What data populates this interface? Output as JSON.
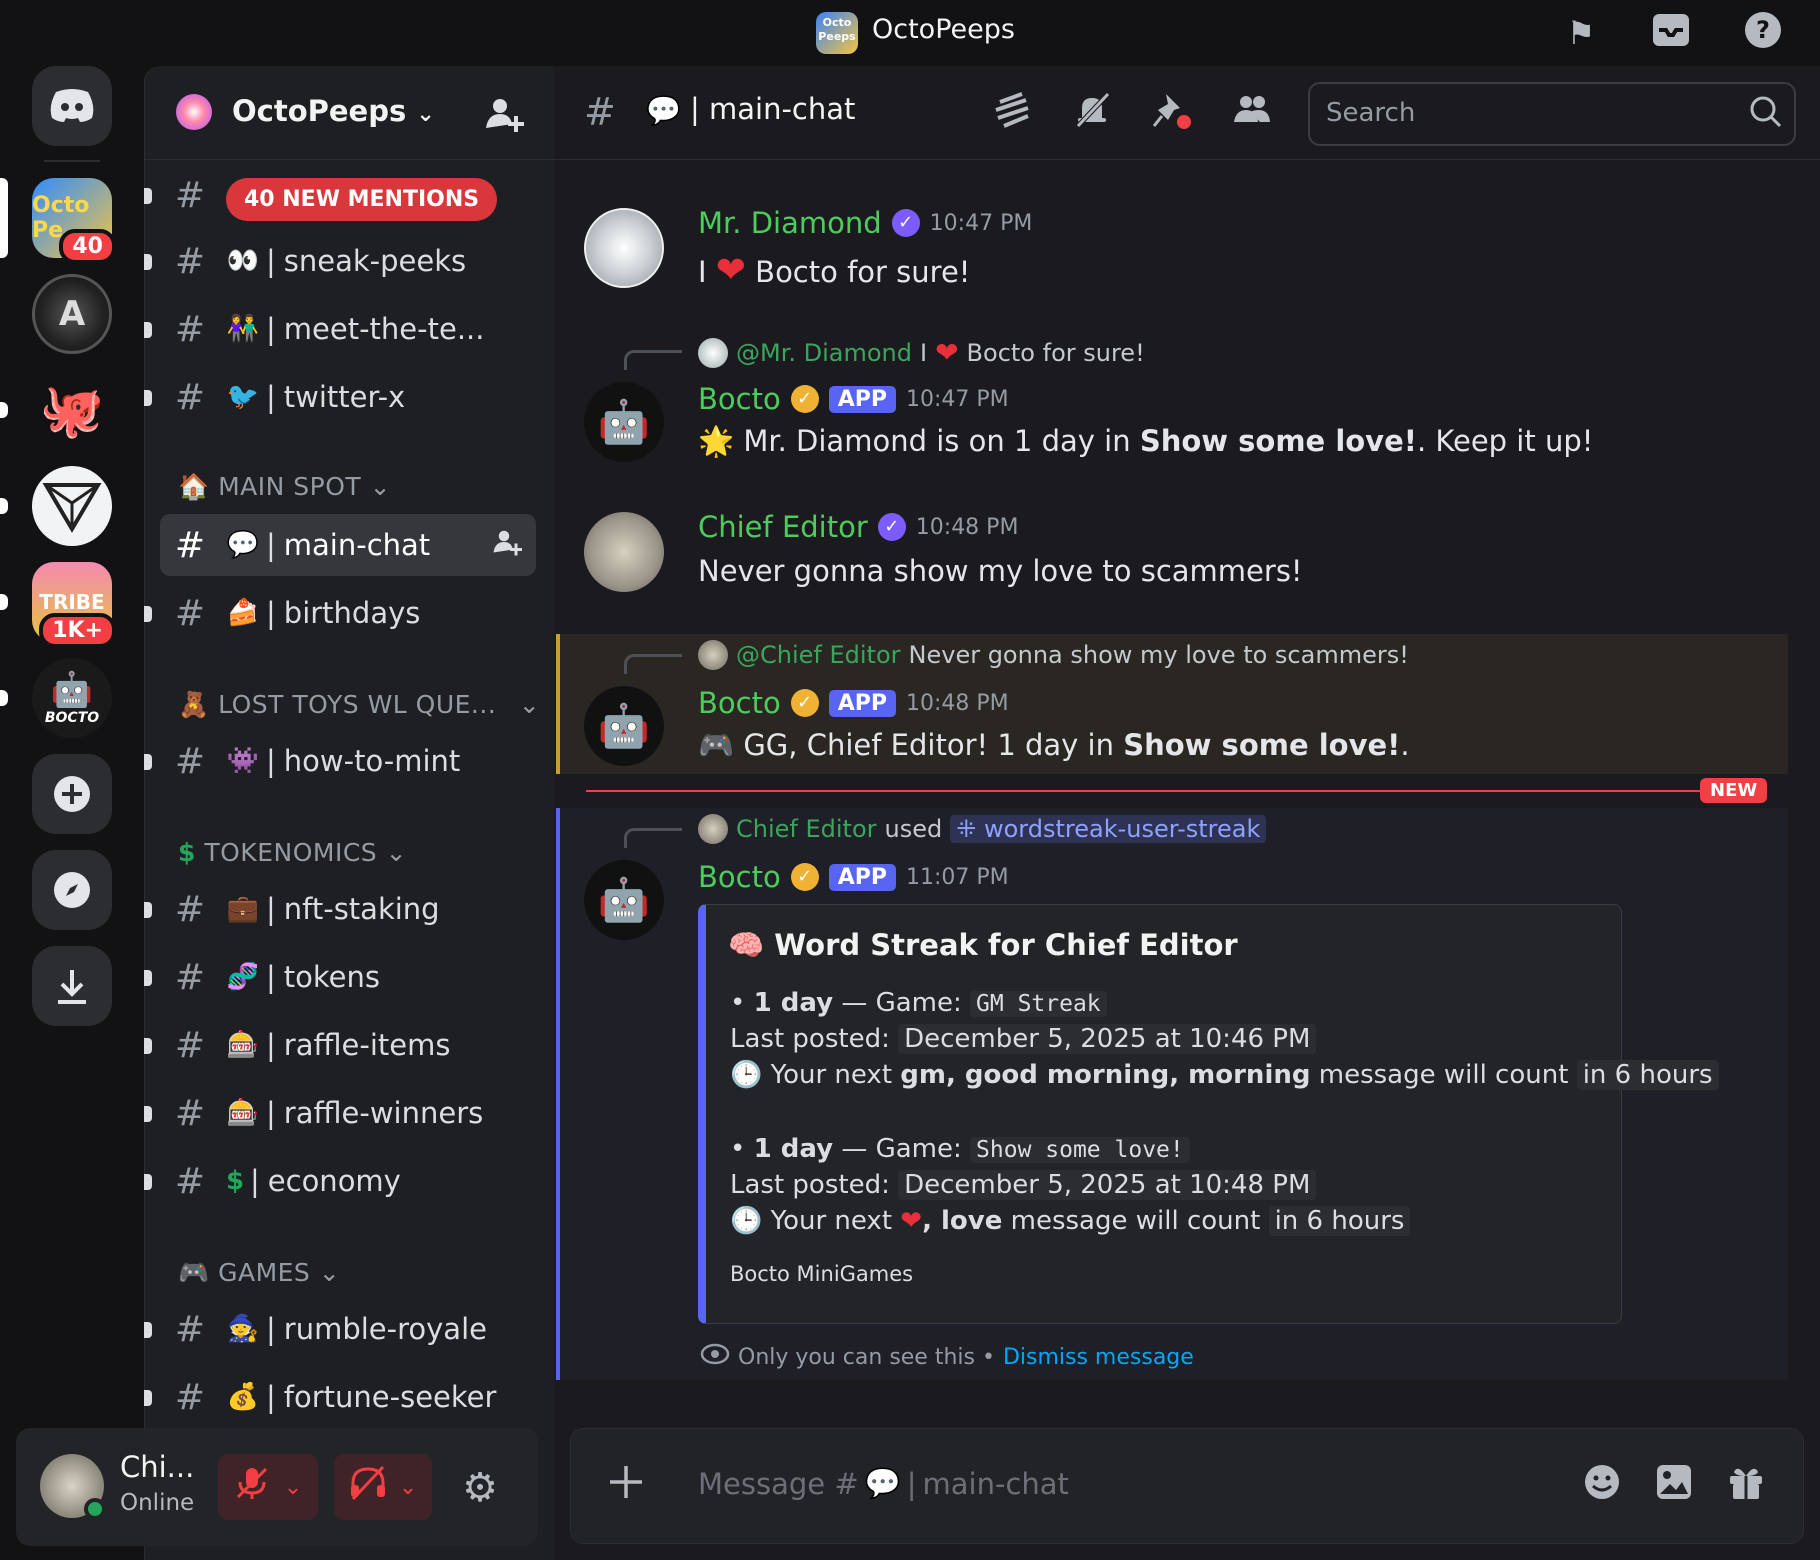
{
  "titlebar": {
    "logo_text": "Octo Peeps",
    "title": "OctoPeeps"
  },
  "rail": {
    "servers": [
      {
        "name": "discord-home",
        "label": "",
        "badge": ""
      },
      {
        "name": "octopeeps",
        "label": "Octo Pe",
        "badge": "40"
      },
      {
        "name": "server-a",
        "label": "A",
        "badge": ""
      },
      {
        "name": "server-octo-miner",
        "label": "",
        "badge": ""
      },
      {
        "name": "server-triangle",
        "label": "",
        "badge": ""
      },
      {
        "name": "server-tribe",
        "label": "TRIBE",
        "badge": "1K+"
      },
      {
        "name": "server-bocto",
        "label": "BOCTO",
        "badge": ""
      }
    ]
  },
  "sidebar": {
    "server_name": "OctoPeeps",
    "mentions_pill": "40 NEW MENTIONS",
    "channels_top": [
      {
        "emoji": "👀",
        "name": "sneak-peeks",
        "locked": true
      },
      {
        "emoji": "👫",
        "name": "meet-the-te...",
        "locked": true
      },
      {
        "emoji": "🐦",
        "name": "twitter-x",
        "locked": false
      }
    ],
    "cat_main": "MAIN SPOT",
    "cat_main_icon": "🏠",
    "channels_main": [
      {
        "emoji": "💬",
        "name": "main-chat",
        "locked": false
      },
      {
        "emoji": "🍰",
        "name": "birthdays",
        "locked": true
      }
    ],
    "cat_lost": "LOST TOYS WL QUE...",
    "cat_lost_icon": "🧸",
    "channels_lost": [
      {
        "emoji": "👾",
        "name": "how-to-mint",
        "locked": true
      }
    ],
    "cat_token": "TOKENOMICS",
    "cat_token_icon": "$",
    "channels_token": [
      {
        "emoji": "💼",
        "name": "nft-staking",
        "locked": true
      },
      {
        "emoji": "🧬",
        "name": "tokens",
        "locked": false
      },
      {
        "emoji": "🎰",
        "name": "raffle-items",
        "locked": true
      },
      {
        "emoji": "🎰",
        "name": "raffle-winners",
        "locked": true
      },
      {
        "emoji": "$",
        "name": "economy",
        "locked": true
      }
    ],
    "cat_games": "GAMES",
    "cat_games_icon": "🎮",
    "channels_games": [
      {
        "emoji": "🧙",
        "name": "rumble-royale",
        "locked": false
      },
      {
        "emoji": "💰",
        "name": "fortune-seeker",
        "locked": true
      }
    ]
  },
  "user": {
    "name": "Chi...",
    "status": "Online"
  },
  "header": {
    "channel_emoji": "💬",
    "channel_name": "main-chat",
    "search_placeholder": "Search"
  },
  "messages": {
    "m1": {
      "author": "Mr. Diamond",
      "time": "10:47 PM",
      "text_a": "I",
      "text_b": "Bocto for sure!"
    },
    "m2": {
      "reply_user": "@Mr. Diamond",
      "reply_a": "I",
      "reply_b": "Bocto for sure!",
      "author": "Bocto",
      "tag": "APP",
      "time": "10:47 PM",
      "text_a": "Mr. Diamond is on 1 day in ",
      "bold": "Show some love!",
      "text_b": ". Keep it up!"
    },
    "m3": {
      "author": "Chief Editor",
      "time": "10:48 PM",
      "text": "Never gonna show my love to scammers!"
    },
    "m4": {
      "reply_user": "@Chief Editor",
      "reply_text": "Never gonna show my love to scammers!",
      "author": "Bocto",
      "tag": "APP",
      "time": "10:48 PM",
      "text_a": "GG, Chief Editor! 1 day in ",
      "bold": "Show some love!",
      "text_b": "."
    },
    "new_label": "NEW",
    "m5": {
      "cmd_user": "Chief Editor",
      "cmd_used": "used",
      "cmd_name": "wordstreak-user-streak",
      "author": "Bocto",
      "tag": "APP",
      "time": "11:07 PM"
    },
    "embed": {
      "title": "Word Streak for Chief Editor",
      "b1_days": "1 day",
      "b1_dash": "— Game:",
      "b1_game": "GM Streak",
      "b1_last_label": "Last posted:",
      "b1_last": "December 5, 2025 at 10:46 PM",
      "b1_next_a": "Your next ",
      "b1_next_bold": "gm, good morning, morning",
      "b1_next_b": " message will count ",
      "b1_when": "in 6 hours",
      "b2_days": "1 day",
      "b2_dash": "— Game:",
      "b2_game": "Show some love!",
      "b2_last_label": "Last posted:",
      "b2_last": "December 5, 2025 at 10:48 PM",
      "b2_next_a": "Your next ",
      "b2_next_bold": ", love",
      "b2_next_b": " message will count ",
      "b2_when": "in 6 hours",
      "footer": "Bocto MiniGames"
    },
    "eph_text": "Only you can see this •",
    "eph_link": "Dismiss message"
  },
  "composer": {
    "placeholder_a": "Message #",
    "placeholder_b": "main-chat"
  },
  "colors": {
    "accent": "#5865f2",
    "mention_red": "#da373c",
    "online": "#23a55a",
    "gold": "#c79e3a",
    "username_green": "#4ecb5d"
  }
}
